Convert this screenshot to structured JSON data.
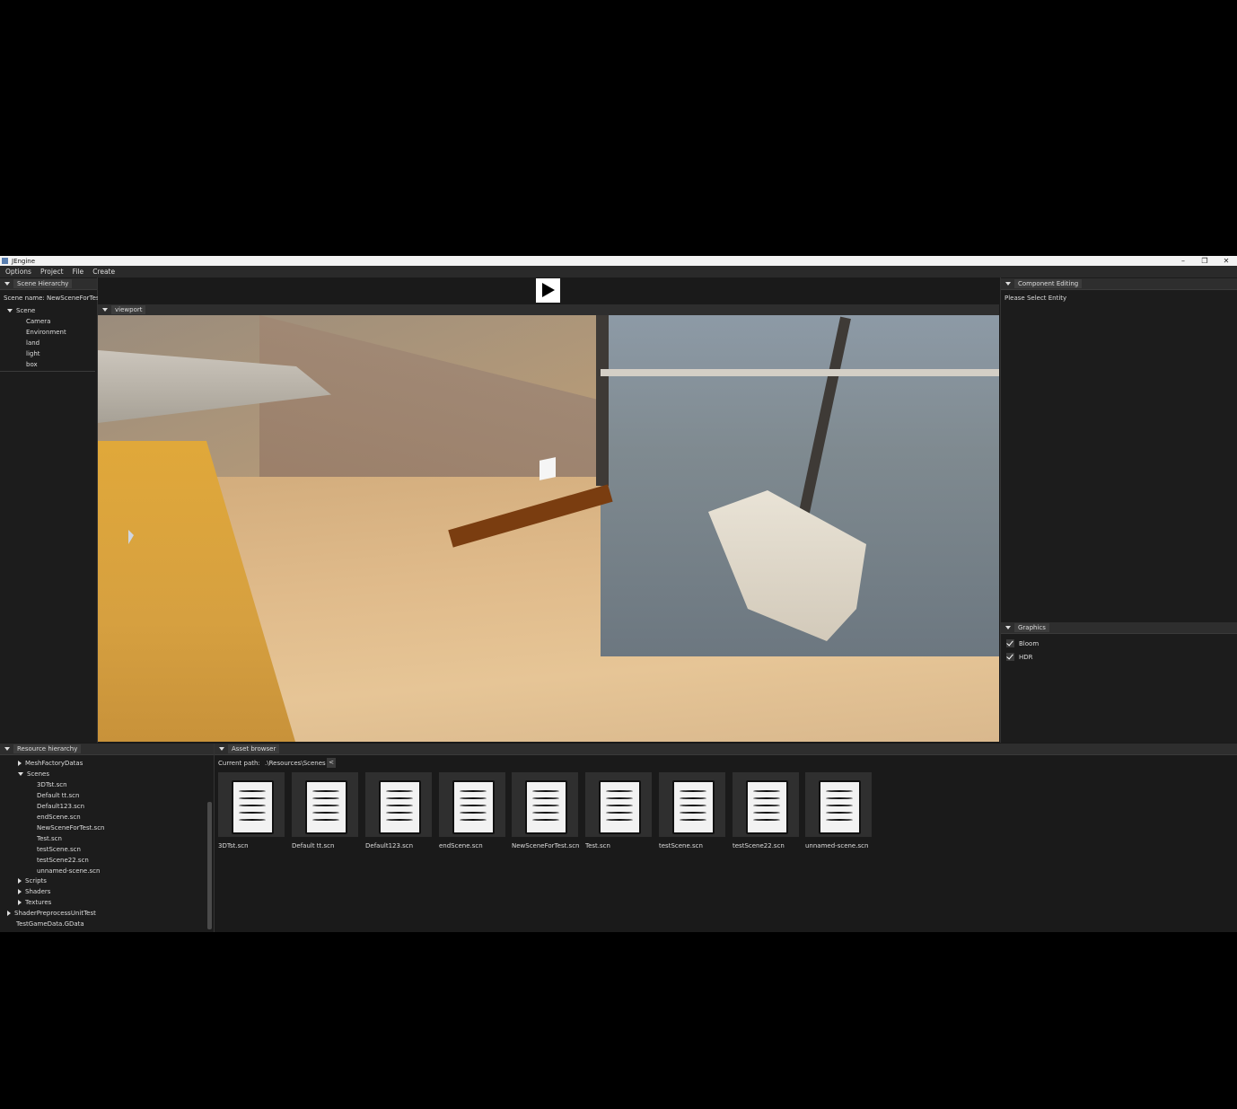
{
  "window": {
    "title": "JEngine",
    "controls": [
      "–",
      "❐",
      "✕"
    ]
  },
  "menu": [
    "Options",
    "Project",
    "File",
    "Create"
  ],
  "scene_hierarchy": {
    "tab": "Scene Hierarchy",
    "scene_name": "Scene name: NewSceneForTes",
    "root": "Scene",
    "children": [
      "Camera",
      "Environment",
      "land",
      "light",
      "box"
    ]
  },
  "viewport": {
    "tab": "viewport"
  },
  "component_editing": {
    "tab": "Component Editing",
    "message": "Please Select Entity"
  },
  "graphics": {
    "tab": "Graphics",
    "options": [
      {
        "label": "Bloom",
        "checked": true
      },
      {
        "label": "HDR",
        "checked": true
      }
    ]
  },
  "resource_hierarchy": {
    "tab": "Resource hierarchy",
    "mesh_folder": "MeshFactoryDatas",
    "scenes_folder": "Scenes",
    "scenes": [
      "3DTst.scn",
      "Default tt.scn",
      "Default123.scn",
      "endScene.scn",
      "NewSceneForTest.scn",
      "Test.scn",
      "testScene.scn",
      "testScene22.scn",
      "unnamed-scene.scn"
    ],
    "folders": [
      "Scripts",
      "Shaders",
      "Textures"
    ],
    "unit_test": "ShaderPreprocessUnitTest",
    "game_data": "TestGameData.GData"
  },
  "asset_browser": {
    "tab": "Asset browser",
    "path_label": "Current path:",
    "path": ".\\Resources\\Scenes",
    "back": "<",
    "files": [
      "3DTst.scn",
      "Default tt.scn",
      "Default123.scn",
      "endScene.scn",
      "NewSceneForTest.scn",
      "Test.scn",
      "testScene.scn",
      "testScene22.scn",
      "unnamed-scene.scn"
    ]
  }
}
